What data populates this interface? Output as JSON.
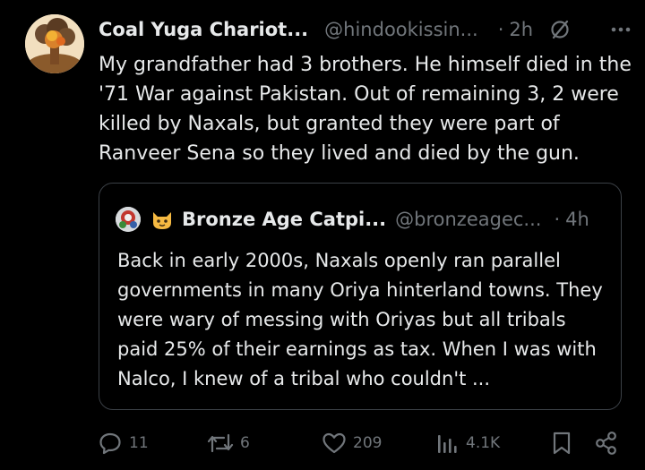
{
  "post": {
    "author_name": "Coal Yuga Chariot...",
    "handle": "@hindookissin...",
    "separator": "·",
    "time": "2h",
    "text": "My grandfather had 3 brothers. He himself died in the '71 War against Pakistan. Out of remaining 3, 2 were killed by Naxals, but granted they were part of Ranveer Sena so they lived and died by the gun."
  },
  "quote": {
    "author_name": "Bronze Age Catpi...",
    "handle": "@bronzeagec...",
    "separator": "·",
    "time": "4h",
    "text": "Back in early 2000s, Naxals openly ran parallel governments in many Oriya hinterland towns. They were wary of messing with Oriyas but all tribals paid  25% of their earnings as tax. When I was with Nalco, I knew of a tribal who couldn't ..."
  },
  "actions": {
    "replies": "11",
    "reposts": "6",
    "likes": "209",
    "views": "4.1K"
  },
  "icons": [
    "grok-icon",
    "more-icon",
    "cat-emoji-icon",
    "reply-icon",
    "repost-icon",
    "like-icon",
    "views-icon",
    "bookmark-icon",
    "share-icon"
  ],
  "colors": {
    "background": "#000000",
    "text": "#e7e9ea",
    "secondary": "#71767b",
    "border": "#3b4046"
  }
}
